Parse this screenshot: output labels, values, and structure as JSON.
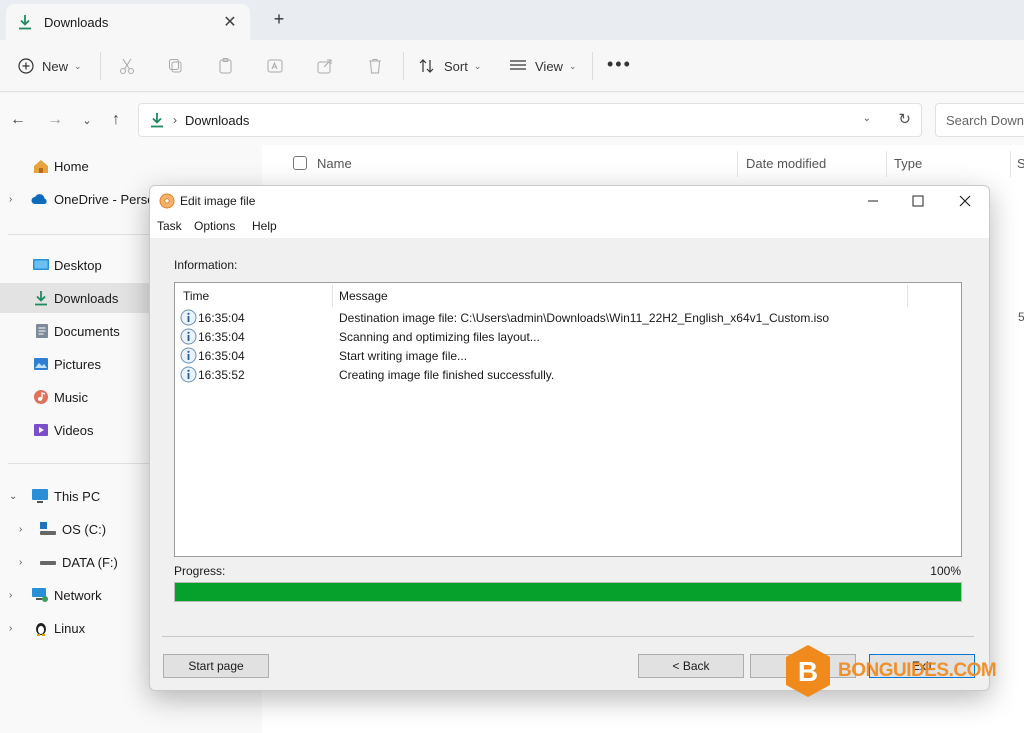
{
  "explorer": {
    "tab": {
      "label": "Downloads",
      "close": "✕"
    },
    "new_tab": "+",
    "toolbar": {
      "new_label": "New",
      "sort_label": "Sort",
      "view_label": "View",
      "more": "•••"
    },
    "address": {
      "crumb": "Downloads",
      "search_placeholder": "Search Downloads"
    },
    "sidebar": {
      "home": "Home",
      "onedrive": "OneDrive - Personal",
      "desktop": "Desktop",
      "downloads": "Downloads",
      "documents": "Documents",
      "pictures": "Pictures",
      "music": "Music",
      "videos": "Videos",
      "this_pc": "This PC",
      "os_c": "OS (C:)",
      "data_f": "DATA (F:)",
      "network": "Network",
      "linux": "Linux"
    },
    "columns": {
      "name": "Name",
      "date_modified": "Date modified",
      "type": "Type",
      "size": "S"
    },
    "partial_cell": "5"
  },
  "dialog": {
    "title": "Edit image file",
    "menu": [
      "Task",
      "Options",
      "Help"
    ],
    "information_label": "Information:",
    "columns": {
      "time": "Time",
      "message": "Message"
    },
    "log": [
      {
        "time": "16:35:04",
        "message": "Destination image file:  C:\\Users\\admin\\Downloads\\Win11_22H2_English_x64v1_Custom.iso"
      },
      {
        "time": "16:35:04",
        "message": "Scanning and optimizing files layout..."
      },
      {
        "time": "16:35:04",
        "message": "Start writing image file..."
      },
      {
        "time": "16:35:52",
        "message": "Creating image file finished successfully."
      }
    ],
    "progress_label": "Progress:",
    "progress_percent": "100%",
    "progress_value": 1.0,
    "buttons": {
      "start_page": "Start page",
      "back": "< Back",
      "next": "Next >",
      "exit": "Exit"
    }
  },
  "watermark": "BONGUIDES.COM",
  "colors": {
    "progress": "#06a12d",
    "accent": "#0078d7",
    "download_icon": "#1f8a5f",
    "watermark": "#f08a1c"
  }
}
